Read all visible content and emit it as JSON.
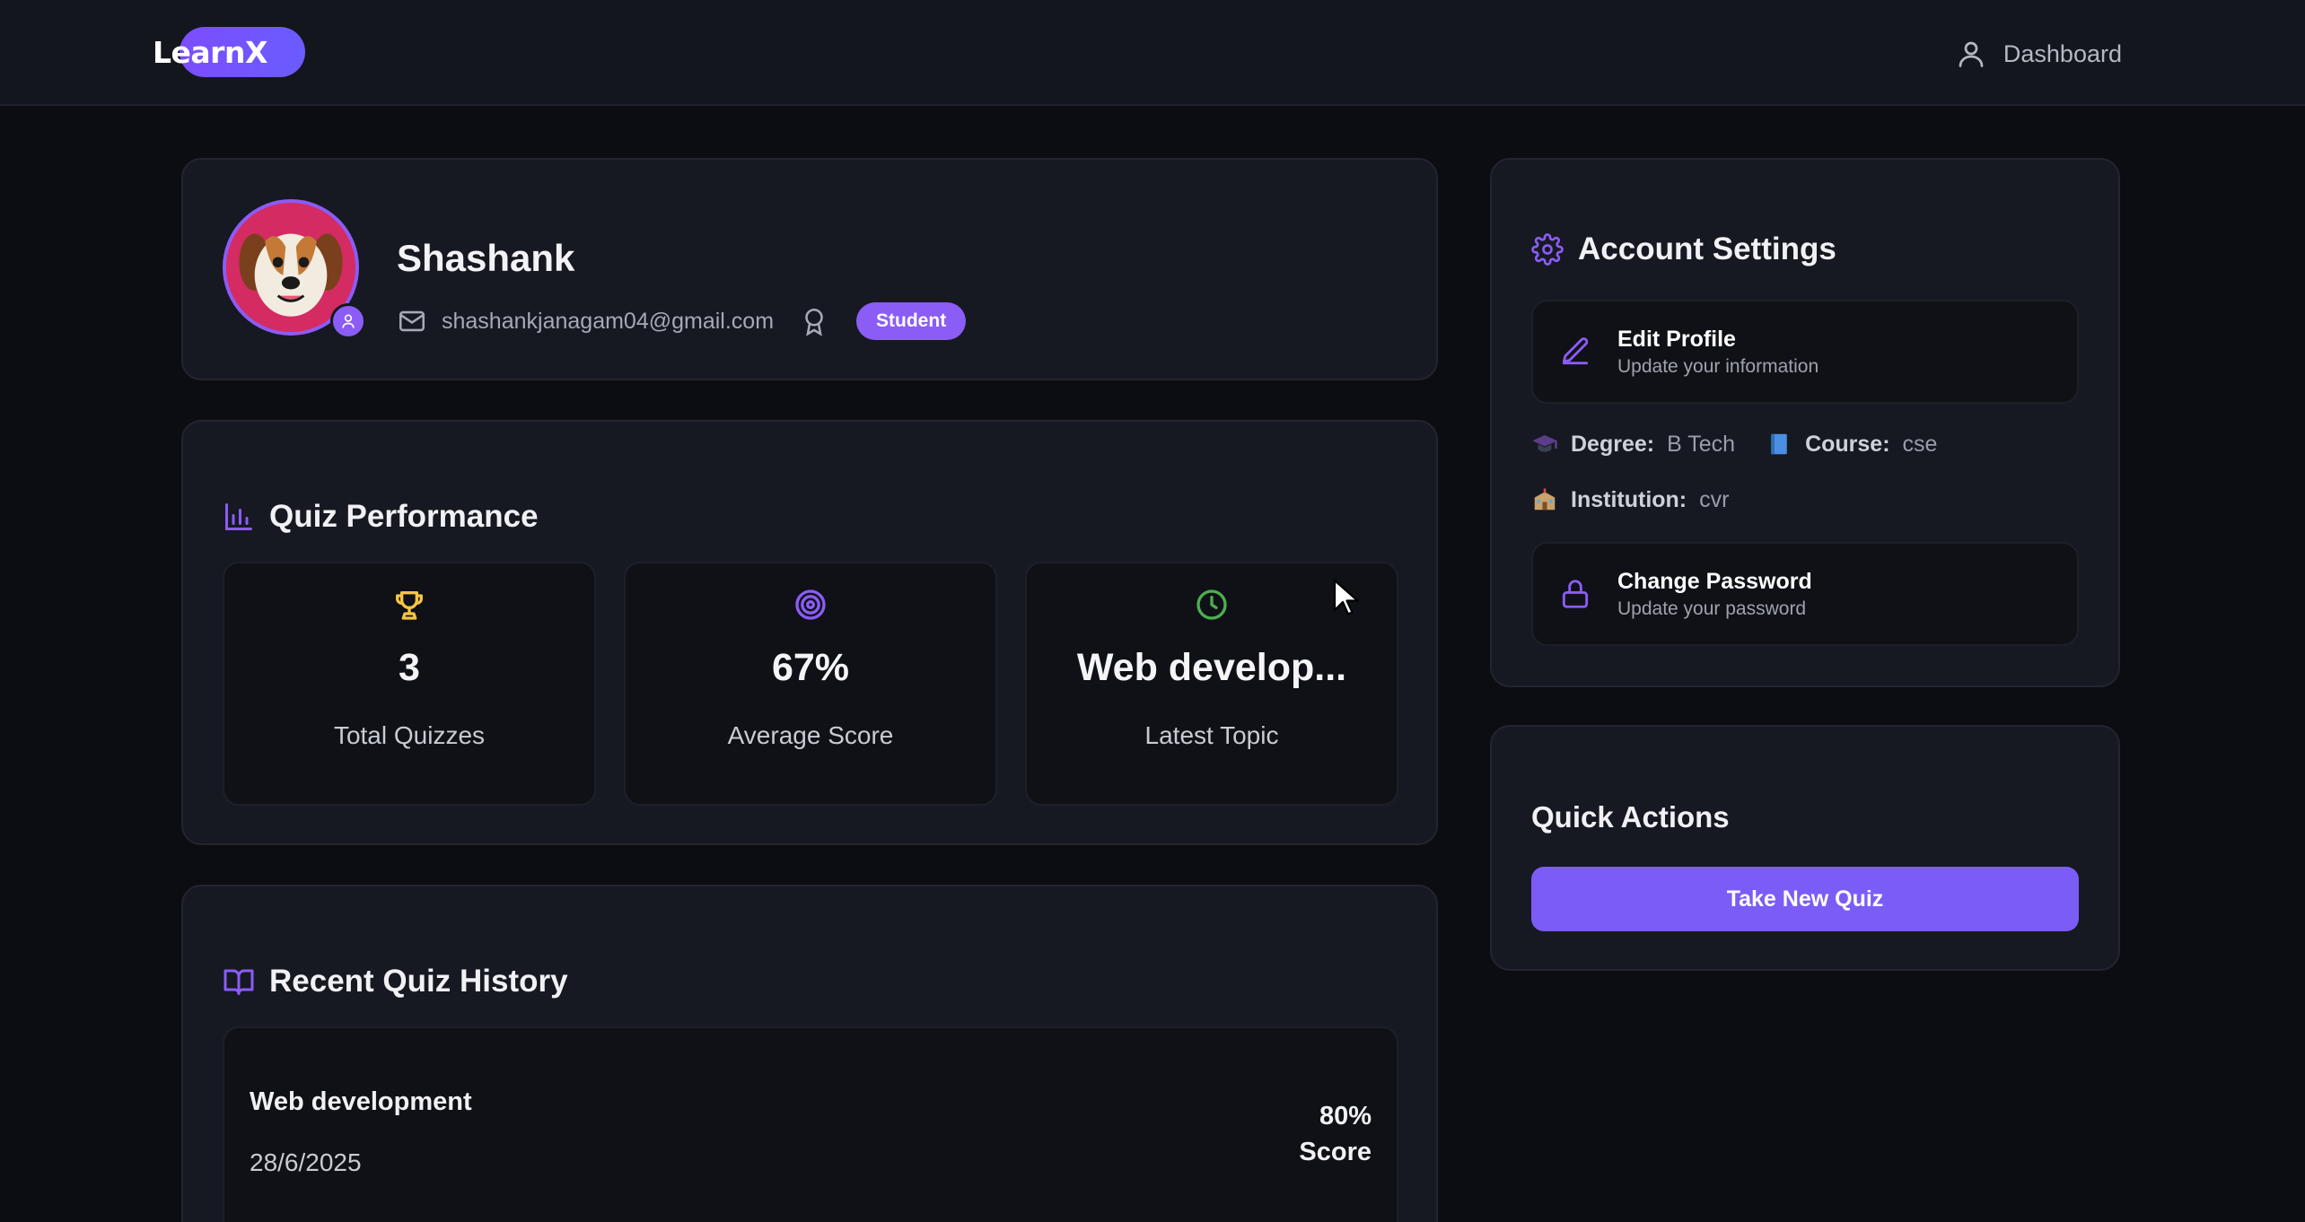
{
  "app": {
    "logo": "LearnX"
  },
  "nav": {
    "dashboard_label": "Dashboard"
  },
  "profile": {
    "name": "Shashank",
    "email": "shashankjanagam04@gmail.com",
    "role": "Student"
  },
  "quiz_performance": {
    "title": "Quiz Performance",
    "stats": [
      {
        "icon": "trophy-icon",
        "value": "3",
        "label": "Total Quizzes"
      },
      {
        "icon": "target-icon",
        "value": "67%",
        "label": "Average Score"
      },
      {
        "icon": "clock-icon",
        "value": "Web develop...",
        "label": "Latest Topic"
      }
    ]
  },
  "history": {
    "title": "Recent Quiz History",
    "items": [
      {
        "topic": "Web development",
        "date": "28/6/2025",
        "score": "80%",
        "score_label": "Score"
      }
    ]
  },
  "account_settings": {
    "title": "Account Settings",
    "edit_profile": {
      "title": "Edit Profile",
      "subtitle": "Update your information"
    },
    "degree_label": "Degree:",
    "degree_value": "B Tech",
    "course_label": "Course:",
    "course_value": "cse",
    "institution_label": "Institution:",
    "institution_value": "cvr",
    "change_password": {
      "title": "Change Password",
      "subtitle": "Update your password"
    }
  },
  "quick_actions": {
    "title": "Quick Actions",
    "take_quiz_label": "Take New Quiz"
  },
  "colors": {
    "accent": "#8b5cf6",
    "background": "#0b0d12",
    "card": "#161921",
    "trophy": "#f5c542",
    "clock": "#4caf50"
  }
}
